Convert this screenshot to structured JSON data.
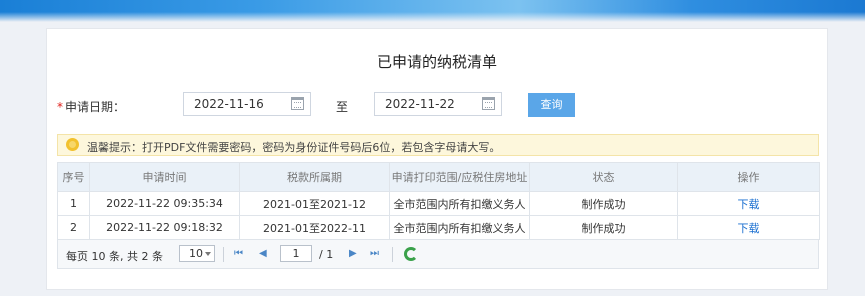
{
  "page": {
    "title": "已申请的纳税清单"
  },
  "filters": {
    "date_label": "申请日期：",
    "required_mark": "*",
    "start_date": "2022-11-16",
    "to_label": "至",
    "end_date": "2022-11-22",
    "query_button": "查询"
  },
  "tip": {
    "text": "温馨提示：打开PDF文件需要密码，密码为身份证件号码后6位，若包含字母请大写。"
  },
  "table": {
    "headers": [
      "序号",
      "申请时间",
      "税款所属期",
      "申请打印范围/应税住房地址",
      "状态",
      "操作"
    ],
    "rows": [
      [
        "1",
        "2022-11-22 09:35:34",
        "2021-01至2021-12",
        "全市范围内所有扣缴义务人",
        "制作成功",
        "下载"
      ],
      [
        "2",
        "2022-11-22 09:18:32",
        "2021-01至2022-11",
        "全市范围内所有扣缴义务人",
        "制作成功",
        "下载"
      ]
    ]
  },
  "pager": {
    "info": "每页 10 条, 共 2 条",
    "page_size": "10",
    "current_page": "1",
    "total_pages": "/ 1",
    "first": "⏮",
    "prev": "◀",
    "next": "▶",
    "last": "⏭"
  }
}
